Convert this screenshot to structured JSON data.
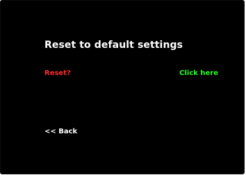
{
  "screen": {
    "title": "Reset to default settings",
    "reset_prompt": "Reset?",
    "confirm_link": "Click here",
    "back_link": "<< Back"
  },
  "colors": {
    "background": "#000000",
    "title": "#ffffff",
    "reset_prompt": "#ff2a2a",
    "confirm_link": "#22ff22",
    "back_link": "#ffffff"
  }
}
